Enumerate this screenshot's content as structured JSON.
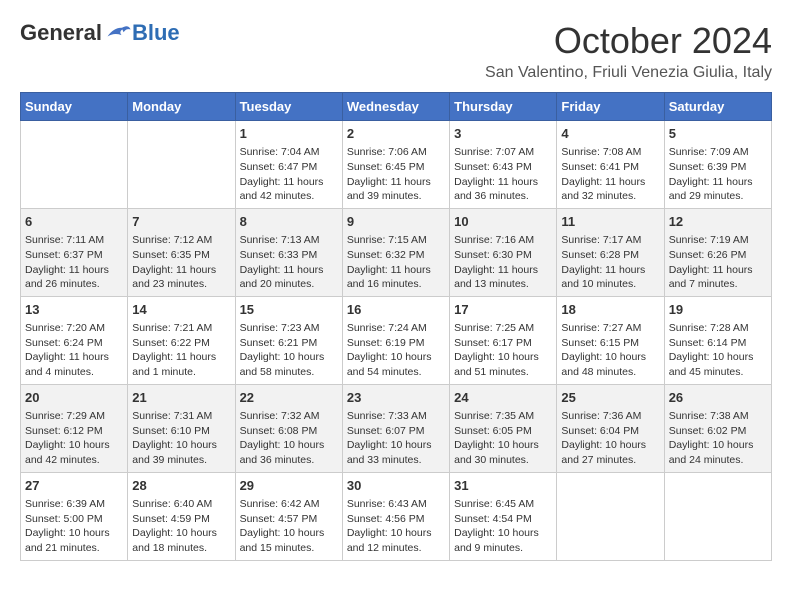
{
  "logo": {
    "general": "General",
    "blue": "Blue"
  },
  "title": "October 2024",
  "location": "San Valentino, Friuli Venezia Giulia, Italy",
  "days_of_week": [
    "Sunday",
    "Monday",
    "Tuesday",
    "Wednesday",
    "Thursday",
    "Friday",
    "Saturday"
  ],
  "weeks": [
    [
      {
        "day": "",
        "info": ""
      },
      {
        "day": "",
        "info": ""
      },
      {
        "day": "1",
        "info": "Sunrise: 7:04 AM\nSunset: 6:47 PM\nDaylight: 11 hours and 42 minutes."
      },
      {
        "day": "2",
        "info": "Sunrise: 7:06 AM\nSunset: 6:45 PM\nDaylight: 11 hours and 39 minutes."
      },
      {
        "day": "3",
        "info": "Sunrise: 7:07 AM\nSunset: 6:43 PM\nDaylight: 11 hours and 36 minutes."
      },
      {
        "day": "4",
        "info": "Sunrise: 7:08 AM\nSunset: 6:41 PM\nDaylight: 11 hours and 32 minutes."
      },
      {
        "day": "5",
        "info": "Sunrise: 7:09 AM\nSunset: 6:39 PM\nDaylight: 11 hours and 29 minutes."
      }
    ],
    [
      {
        "day": "6",
        "info": "Sunrise: 7:11 AM\nSunset: 6:37 PM\nDaylight: 11 hours and 26 minutes."
      },
      {
        "day": "7",
        "info": "Sunrise: 7:12 AM\nSunset: 6:35 PM\nDaylight: 11 hours and 23 minutes."
      },
      {
        "day": "8",
        "info": "Sunrise: 7:13 AM\nSunset: 6:33 PM\nDaylight: 11 hours and 20 minutes."
      },
      {
        "day": "9",
        "info": "Sunrise: 7:15 AM\nSunset: 6:32 PM\nDaylight: 11 hours and 16 minutes."
      },
      {
        "day": "10",
        "info": "Sunrise: 7:16 AM\nSunset: 6:30 PM\nDaylight: 11 hours and 13 minutes."
      },
      {
        "day": "11",
        "info": "Sunrise: 7:17 AM\nSunset: 6:28 PM\nDaylight: 11 hours and 10 minutes."
      },
      {
        "day": "12",
        "info": "Sunrise: 7:19 AM\nSunset: 6:26 PM\nDaylight: 11 hours and 7 minutes."
      }
    ],
    [
      {
        "day": "13",
        "info": "Sunrise: 7:20 AM\nSunset: 6:24 PM\nDaylight: 11 hours and 4 minutes."
      },
      {
        "day": "14",
        "info": "Sunrise: 7:21 AM\nSunset: 6:22 PM\nDaylight: 11 hours and 1 minute."
      },
      {
        "day": "15",
        "info": "Sunrise: 7:23 AM\nSunset: 6:21 PM\nDaylight: 10 hours and 58 minutes."
      },
      {
        "day": "16",
        "info": "Sunrise: 7:24 AM\nSunset: 6:19 PM\nDaylight: 10 hours and 54 minutes."
      },
      {
        "day": "17",
        "info": "Sunrise: 7:25 AM\nSunset: 6:17 PM\nDaylight: 10 hours and 51 minutes."
      },
      {
        "day": "18",
        "info": "Sunrise: 7:27 AM\nSunset: 6:15 PM\nDaylight: 10 hours and 48 minutes."
      },
      {
        "day": "19",
        "info": "Sunrise: 7:28 AM\nSunset: 6:14 PM\nDaylight: 10 hours and 45 minutes."
      }
    ],
    [
      {
        "day": "20",
        "info": "Sunrise: 7:29 AM\nSunset: 6:12 PM\nDaylight: 10 hours and 42 minutes."
      },
      {
        "day": "21",
        "info": "Sunrise: 7:31 AM\nSunset: 6:10 PM\nDaylight: 10 hours and 39 minutes."
      },
      {
        "day": "22",
        "info": "Sunrise: 7:32 AM\nSunset: 6:08 PM\nDaylight: 10 hours and 36 minutes."
      },
      {
        "day": "23",
        "info": "Sunrise: 7:33 AM\nSunset: 6:07 PM\nDaylight: 10 hours and 33 minutes."
      },
      {
        "day": "24",
        "info": "Sunrise: 7:35 AM\nSunset: 6:05 PM\nDaylight: 10 hours and 30 minutes."
      },
      {
        "day": "25",
        "info": "Sunrise: 7:36 AM\nSunset: 6:04 PM\nDaylight: 10 hours and 27 minutes."
      },
      {
        "day": "26",
        "info": "Sunrise: 7:38 AM\nSunset: 6:02 PM\nDaylight: 10 hours and 24 minutes."
      }
    ],
    [
      {
        "day": "27",
        "info": "Sunrise: 6:39 AM\nSunset: 5:00 PM\nDaylight: 10 hours and 21 minutes."
      },
      {
        "day": "28",
        "info": "Sunrise: 6:40 AM\nSunset: 4:59 PM\nDaylight: 10 hours and 18 minutes."
      },
      {
        "day": "29",
        "info": "Sunrise: 6:42 AM\nSunset: 4:57 PM\nDaylight: 10 hours and 15 minutes."
      },
      {
        "day": "30",
        "info": "Sunrise: 6:43 AM\nSunset: 4:56 PM\nDaylight: 10 hours and 12 minutes."
      },
      {
        "day": "31",
        "info": "Sunrise: 6:45 AM\nSunset: 4:54 PM\nDaylight: 10 hours and 9 minutes."
      },
      {
        "day": "",
        "info": ""
      },
      {
        "day": "",
        "info": ""
      }
    ]
  ]
}
